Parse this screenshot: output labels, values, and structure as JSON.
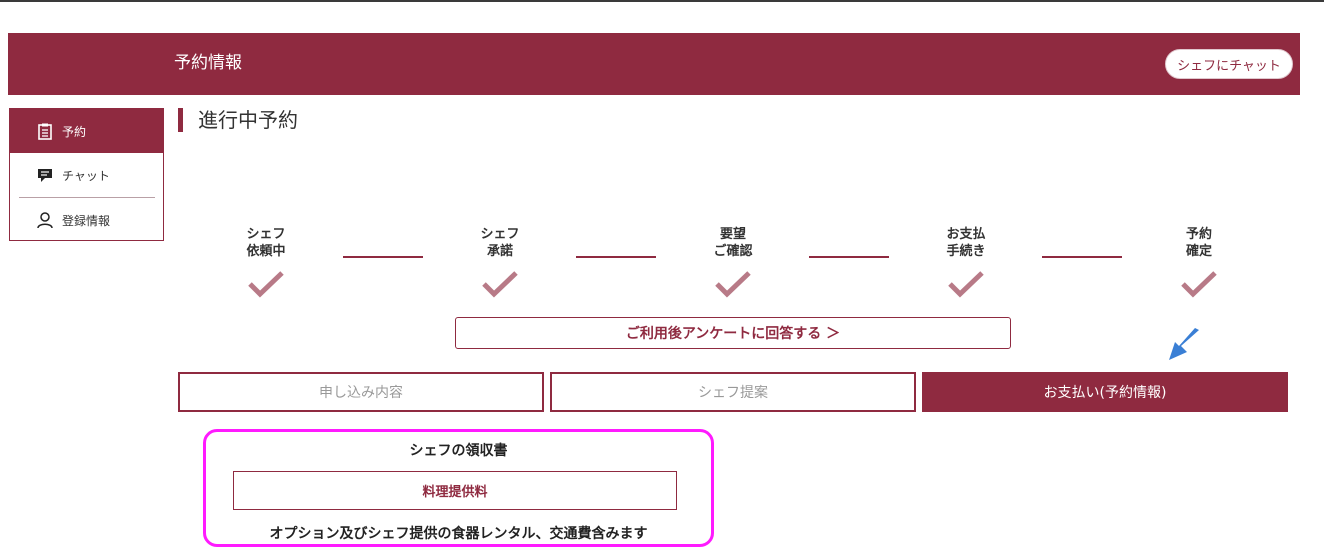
{
  "header": {
    "title": "予約情報",
    "chat_button": "シェフにチャット"
  },
  "sidebar": {
    "items": [
      {
        "label": "予約",
        "icon": "clipboard-icon",
        "active": true
      },
      {
        "label": "チャット",
        "icon": "chat-bubble-icon",
        "active": false
      },
      {
        "label": "登録情報",
        "icon": "user-icon",
        "active": false
      }
    ]
  },
  "section_title": "進行中予約",
  "progress": {
    "steps": [
      {
        "line1": "シェフ",
        "line2": "依頼中"
      },
      {
        "line1": "シェフ",
        "line2": "承諾"
      },
      {
        "line1": "要望",
        "line2": "ご確認"
      },
      {
        "line1": "お支払",
        "line2": "手続き"
      },
      {
        "line1": "予約",
        "line2": "確定"
      }
    ]
  },
  "survey_button": "ご利用後アンケートに回答する ＞",
  "tabs": [
    {
      "label": "申し込み内容",
      "active": false
    },
    {
      "label": "シェフ提案",
      "active": false
    },
    {
      "label": "お支払い(予約情報)",
      "active": true
    }
  ],
  "receipt": {
    "title": "シェフの領収書",
    "item": "料理提供料",
    "note": "オプション及びシェフ提供の食器レンタル、交通費含みます"
  },
  "colors": {
    "brand": "#8f2a40",
    "check": "#b87a87",
    "highlight": "#ff1aff",
    "arrow": "#3a7fd5"
  }
}
